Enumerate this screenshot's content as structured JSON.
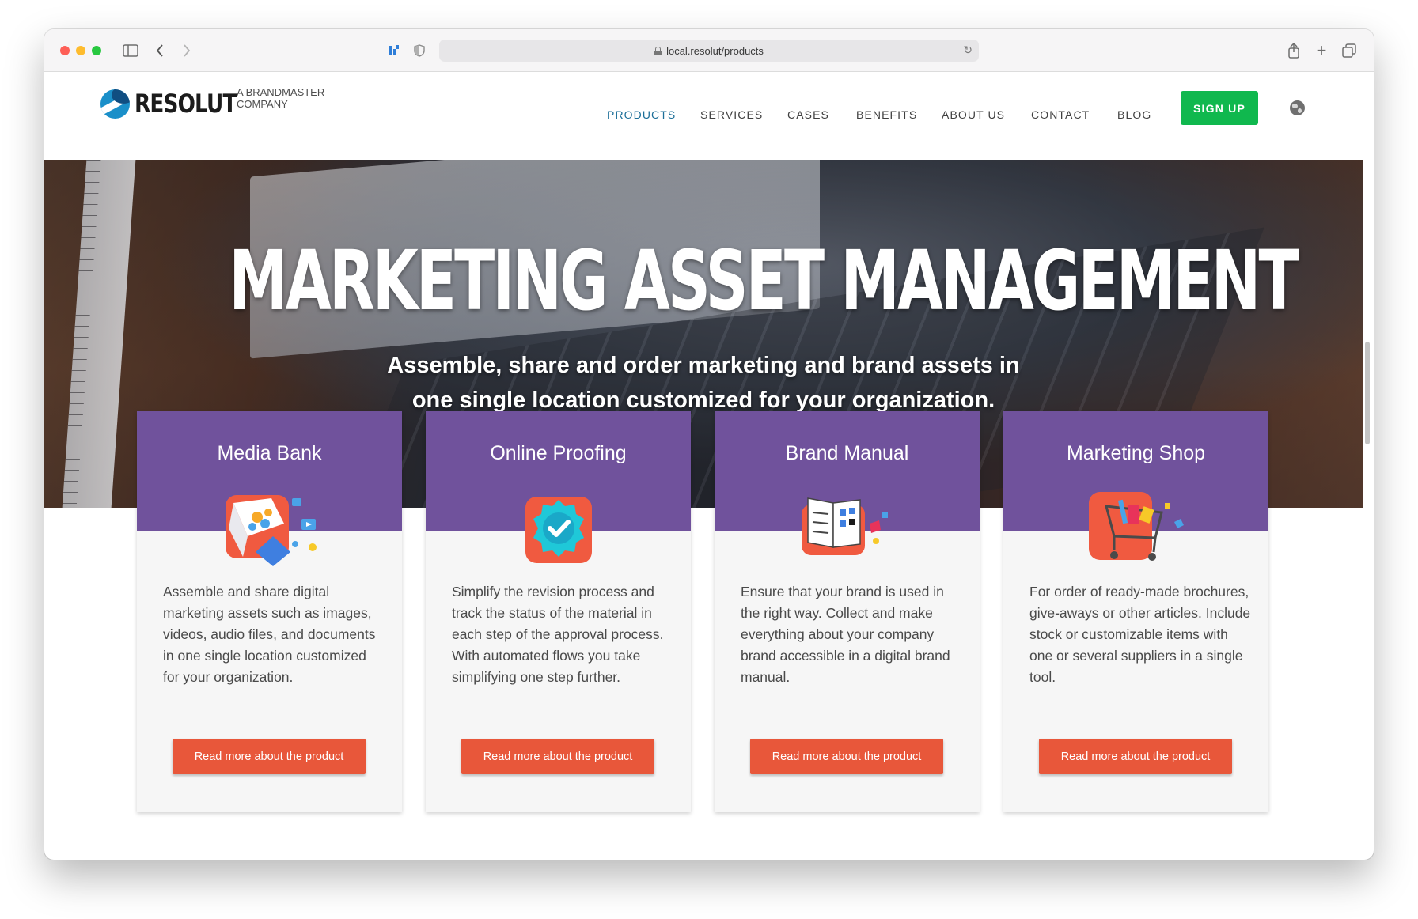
{
  "browser": {
    "url": "local.resolut/products"
  },
  "brand": {
    "name": "RESOLUT",
    "tagline": "A BRANDMASTER COMPANY"
  },
  "nav": {
    "items": [
      {
        "label": "PRODUCTS",
        "active": true
      },
      {
        "label": "SERVICES",
        "active": false
      },
      {
        "label": "CASES",
        "active": false
      },
      {
        "label": "BENEFITS",
        "active": false
      },
      {
        "label": "ABOUT US",
        "active": false
      },
      {
        "label": "CONTACT",
        "active": false
      },
      {
        "label": "BLOG",
        "active": false
      }
    ],
    "signup": "SIGN UP"
  },
  "hero": {
    "title": "MARKETING ASSET MANAGEMENT",
    "subtitle": "Assemble, share and order marketing and brand assets in one single location customized for your organization."
  },
  "cards": [
    {
      "title": "Media Bank",
      "icon": "media-box-icon",
      "body": "Assemble and share digital marketing assets such as images, videos, audio files, and documents in one single location customized for your organization.",
      "button": "Read more about the product"
    },
    {
      "title": "Online Proofing",
      "icon": "approval-badge-icon",
      "body": "Simplify the revision process and track the status of the material in each step of the approval process. With automated flows you take simplifying one step further.",
      "button": "Read more about the product"
    },
    {
      "title": "Brand Manual",
      "icon": "brand-book-icon",
      "body": "Ensure that your brand is used in the right way. Collect and make everything about your company brand accessible in a digital brand manual.",
      "button": "Read more about the product"
    },
    {
      "title": "Marketing Shop",
      "icon": "shopping-cart-icon",
      "body": "For order of ready-made brochures, give-aways or other articles. Include stock or customizable items with one or several suppliers in a single tool.",
      "button": "Read more about the product"
    }
  ],
  "colors": {
    "card_header": "#70529c",
    "cta": "#e8573a",
    "signup": "#10b84e",
    "nav_active": "#1b6e98"
  }
}
